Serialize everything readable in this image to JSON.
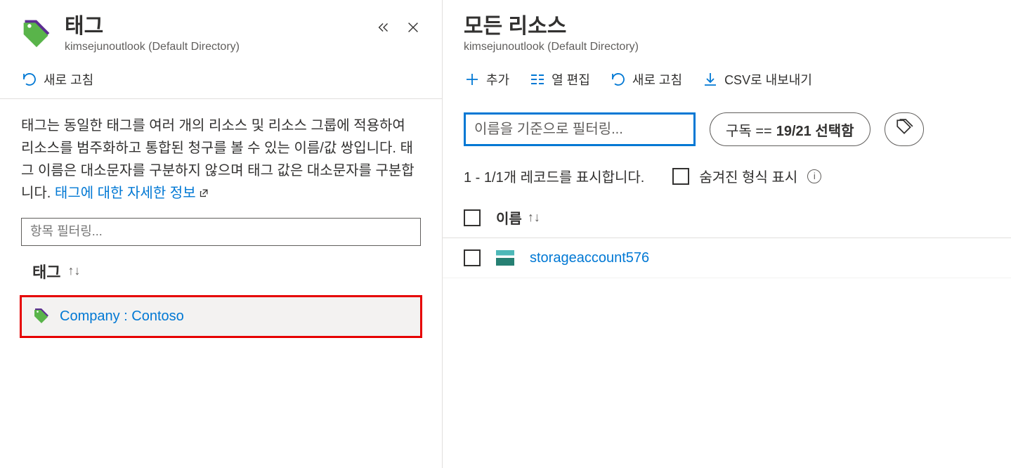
{
  "left": {
    "title": "태그",
    "subtitle": "kimsejunoutlook (Default Directory)",
    "refresh": "새로 고침",
    "desc_part1": "태그는 동일한 태그를 여러 개의 리소스 및 리소스 그룹에 적용하여 리소스를 범주화하고 통합된 청구를 볼 수 있는 이름/값 쌍입니다. 태그 이름은 대소문자를 구분하지 않으며 태그 값은 대소문자를 구분합니다. ",
    "desc_link": "태그에 대한 자세한 정보",
    "filter_placeholder": "항목 필터링...",
    "section_heading": "태그",
    "tag_item": "Company : Contoso"
  },
  "right": {
    "title": "모든 리소스",
    "subtitle": "kimsejunoutlook (Default Directory)",
    "toolbar": {
      "add": "추가",
      "edit_columns": "열 편집",
      "refresh": "새로 고침",
      "export_csv": "CSV로 내보내기"
    },
    "name_filter_placeholder": "이름을 기준으로 필터링...",
    "subscription_pill_prefix": "구독 == ",
    "subscription_pill_bold": "19/21 선택함",
    "records_text": "1 - 1/1개 레코드를 표시합니다.",
    "show_hidden": "숨겨진 형식 표시",
    "col_name": "이름",
    "resource_name": "storageaccount576"
  }
}
